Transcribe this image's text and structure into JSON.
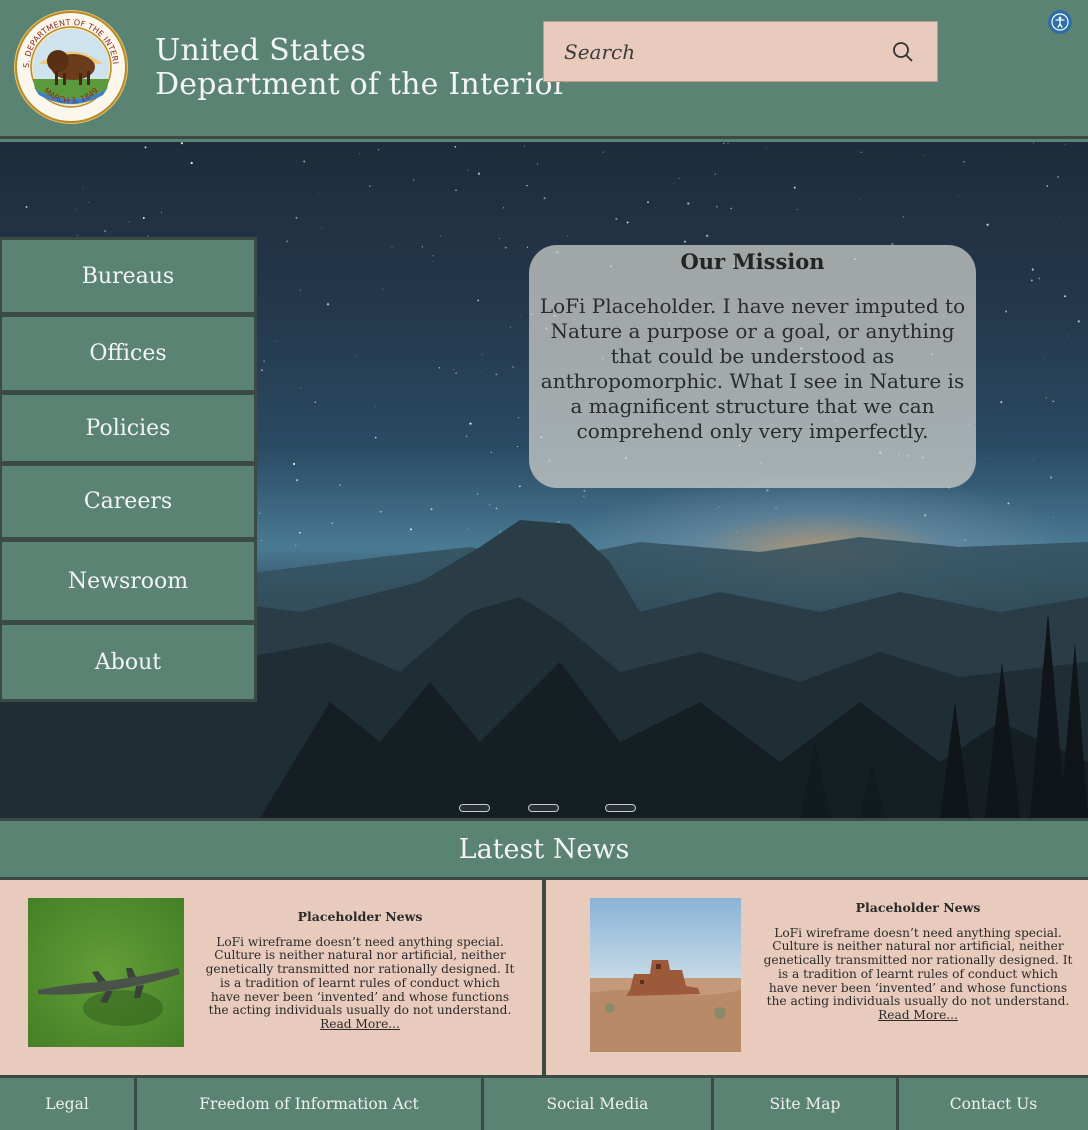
{
  "header": {
    "title_line1": "United States",
    "title_line2": "Department of the Interior",
    "seal": {
      "top_text": "U.S. DEPARTMENT OF THE INTERIOR",
      "bottom_text": "MARCH 3, 1849"
    },
    "search_placeholder": "Search",
    "search_icon": "magnifier-icon",
    "accessibility_icon": "accessibility-icon"
  },
  "sidebar": {
    "items": [
      {
        "label": "Bureaus"
      },
      {
        "label": "Offices"
      },
      {
        "label": "Policies"
      },
      {
        "label": "Careers"
      },
      {
        "label": "Newsroom"
      },
      {
        "label": "About"
      }
    ]
  },
  "mission": {
    "title": "Our Mission",
    "text": "LoFi Placeholder. I have never imputed to Nature a purpose or a goal, or anything that could be understood as anthropomorphic. What I see in Nature is a magnificent structure that we can comprehend only very imperfectly."
  },
  "carousel": {
    "slide_count": 3
  },
  "news": {
    "heading": "Latest News",
    "items": [
      {
        "title": "Placeholder News",
        "body": "LoFi wireframe doesn’t need anything special. Culture is neither natural nor artificial, neither genetically transmitted nor rationally designed. It is a tradition of learnt rules of conduct which have never been ‘invented’ and whose functions the acting individuals usually do not understand.",
        "link": "Read More..."
      },
      {
        "title": "Placeholder News",
        "body": "LoFi wireframe doesn’t need anything special. Culture is neither natural nor artificial, neither genetically transmitted nor rationally designed. It is a tradition of learnt rules of conduct which have never been ‘invented’ and whose functions the acting individuals usually do not understand.",
        "link": "Read More..."
      }
    ]
  },
  "footer": {
    "links": [
      {
        "label": "Legal"
      },
      {
        "label": "Freedom of Information Act"
      },
      {
        "label": "Social Media"
      },
      {
        "label": "Site Map"
      },
      {
        "label": "Contact Us"
      }
    ]
  },
  "colors": {
    "primary_green": "#5b8374",
    "border_dark": "#3c4a46",
    "sand": "#e8cbbd"
  }
}
